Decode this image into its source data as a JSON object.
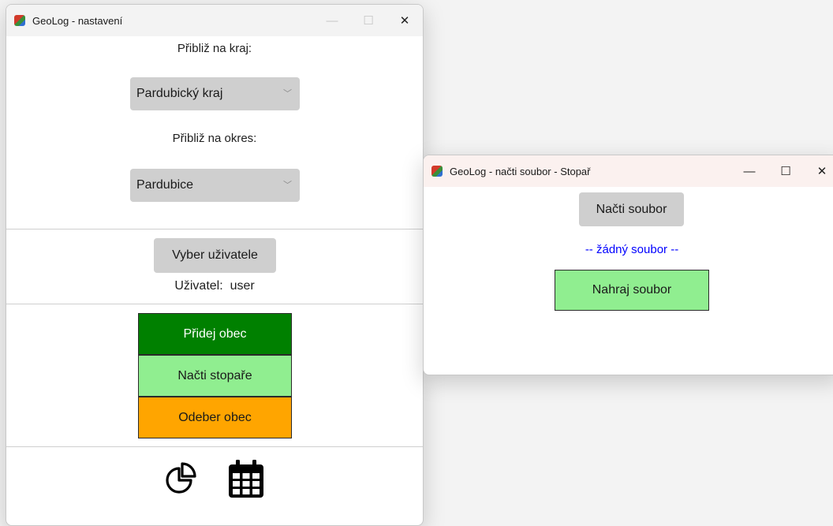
{
  "settings_window": {
    "title": "GeoLog - nastavení",
    "minimize_glyph": "—",
    "maximize_glyph": "☐",
    "close_glyph": "✕",
    "region_label": "Přibliž na kraj:",
    "region_value": "Pardubický kraj",
    "district_label": "Přibliž na okres:",
    "district_value": "Pardubice",
    "dropdown_glyph": "﹀",
    "choose_user_label": "Vyber uživatele",
    "user_label": "Uživatel:",
    "user_value": "user",
    "add_municipality_label": "Přidej obec",
    "load_hitchhiker_label": "Načti stopaře",
    "remove_municipality_label": "Odeber obec",
    "icons": [
      "pie-chart-icon",
      "calendar-icon"
    ]
  },
  "file_window": {
    "title": "GeoLog - načti soubor - Stopař",
    "minimize_glyph": "—",
    "maximize_glyph": "☐",
    "close_glyph": "✕",
    "load_file_label": "Načti soubor",
    "no_file_text": "-- žádný soubor --",
    "upload_file_label": "Nahraj soubor"
  },
  "colors": {
    "add_button": "#008000",
    "load_button": "#90ee90",
    "remove_button": "#ffa500",
    "upload_button": "#90ee90",
    "no_file_text": "#0000ff"
  }
}
